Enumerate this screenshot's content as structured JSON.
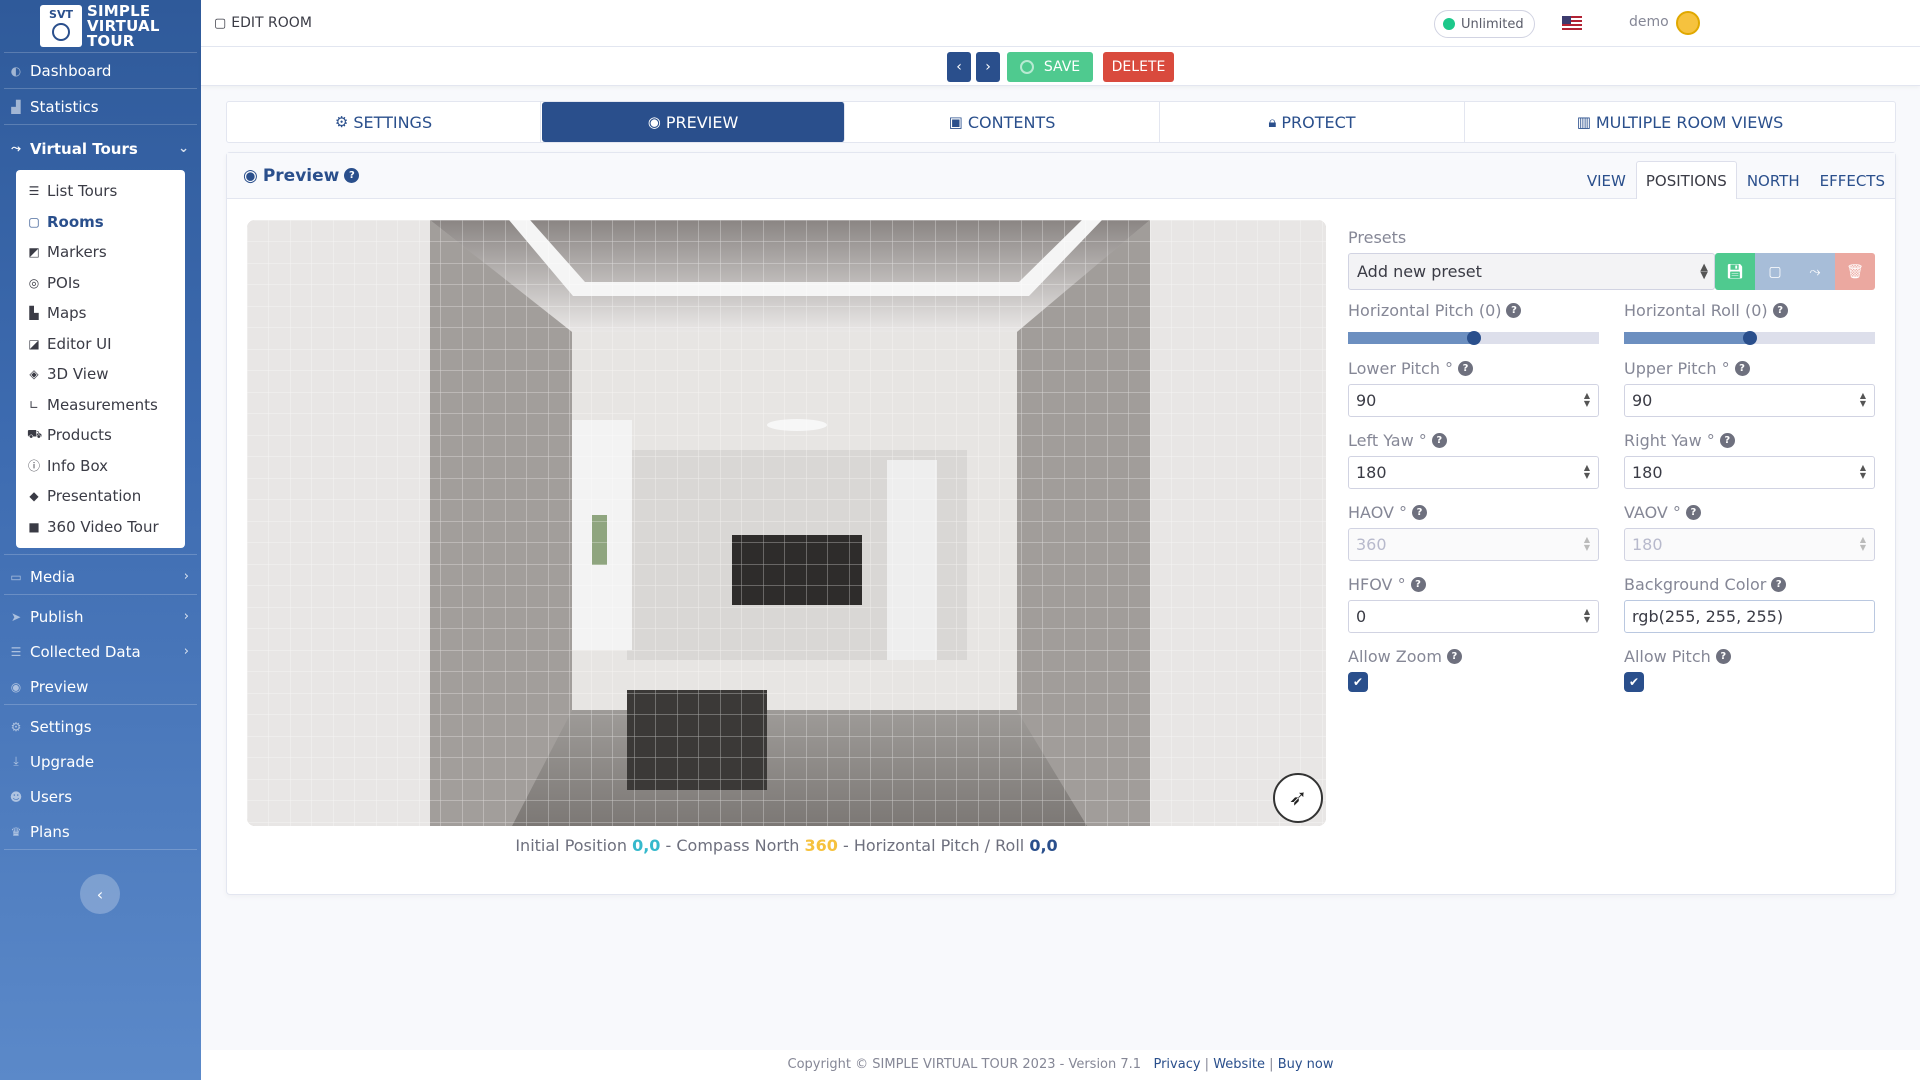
{
  "brand": {
    "abbr": "SVT",
    "line1": "SIMPLE",
    "line2": "VIRTUAL",
    "line3": "TOUR"
  },
  "sidebar": {
    "top_items": [
      {
        "label": "Dashboard",
        "icon": "gauge-icon"
      },
      {
        "label": "Statistics",
        "icon": "chart-area-icon"
      }
    ],
    "virtual_tours": {
      "label": "Virtual Tours",
      "icon": "route-icon"
    },
    "sub_items": [
      {
        "label": "List Tours",
        "icon": "list-icon"
      },
      {
        "label": "Rooms",
        "icon": "vector-square-icon"
      },
      {
        "label": "Markers",
        "icon": "caret-square-icon"
      },
      {
        "label": "POIs",
        "icon": "bullseye-icon"
      },
      {
        "label": "Maps",
        "icon": "map-icon"
      },
      {
        "label": "Editor UI",
        "icon": "drafting-icon"
      },
      {
        "label": "3D View",
        "icon": "cube-icon"
      },
      {
        "label": "Measurements",
        "icon": "ruler-icon"
      },
      {
        "label": "Products",
        "icon": "cart-icon"
      },
      {
        "label": "Info Box",
        "icon": "info-icon"
      },
      {
        "label": "Presentation",
        "icon": "diamond-icon"
      },
      {
        "label": "360 Video Tour",
        "icon": "video-icon"
      }
    ],
    "media": "Media",
    "publish": "Publish",
    "collected": "Collected Data",
    "preview": "Preview",
    "settings": "Settings",
    "upgrade": "Upgrade",
    "users": "Users",
    "plans": "Plans"
  },
  "topbar": {
    "title": "EDIT ROOM",
    "plan_badge": "Unlimited",
    "username": "demo"
  },
  "actions": {
    "prev": "‹",
    "next": "›",
    "save": "SAVE",
    "delete": "DELETE"
  },
  "tabs": {
    "settings": "SETTINGS",
    "preview": "PREVIEW",
    "contents": "CONTENTS",
    "protect": "PROTECT",
    "multiple": "MULTIPLE ROOM VIEWS"
  },
  "preview": {
    "title": "Preview",
    "subtabs": {
      "view": "VIEW",
      "positions": "POSITIONS",
      "north": "NORTH",
      "effects": "EFFECTS"
    },
    "info": {
      "initial_label": "Initial Position",
      "initial_value": "0,0",
      "compass_label": "- Compass North",
      "compass_value": "360",
      "pitch_label": "- Horizontal Pitch / Roll",
      "pitch_value": "0,0"
    }
  },
  "form": {
    "presets_label": "Presets",
    "preset_value": "Add new preset",
    "h_pitch_label": "Horizontal Pitch (0)",
    "h_pitch_level": 0.5,
    "h_roll_label": "Horizontal Roll (0)",
    "h_roll_level": 0.5,
    "lower_pitch_label": "Lower Pitch °",
    "lower_pitch": "90",
    "upper_pitch_label": "Upper Pitch °",
    "upper_pitch": "90",
    "left_yaw_label": "Left Yaw °",
    "left_yaw": "180",
    "right_yaw_label": "Right Yaw °",
    "right_yaw": "180",
    "haov_label": "HAOV °",
    "haov": "360",
    "vaov_label": "VAOV °",
    "vaov": "180",
    "hfov_label": "HFOV °",
    "hfov": "0",
    "bg_label": "Background Color",
    "bg_value": "rgb(255, 255, 255)",
    "allow_zoom_label": "Allow Zoom",
    "allow_zoom": true,
    "allow_pitch_label": "Allow Pitch",
    "allow_pitch": true
  },
  "footer": {
    "copyright": "Copyright © SIMPLE VIRTUAL TOUR 2023 - Version 7.1",
    "privacy": "Privacy",
    "website": "Website",
    "buy": "Buy now"
  },
  "colors": {
    "primary": "#2a4f8c",
    "success": "#4fca8f",
    "danger": "#d94a3d",
    "info": "#36b9cc",
    "warning": "#f6c23e"
  }
}
